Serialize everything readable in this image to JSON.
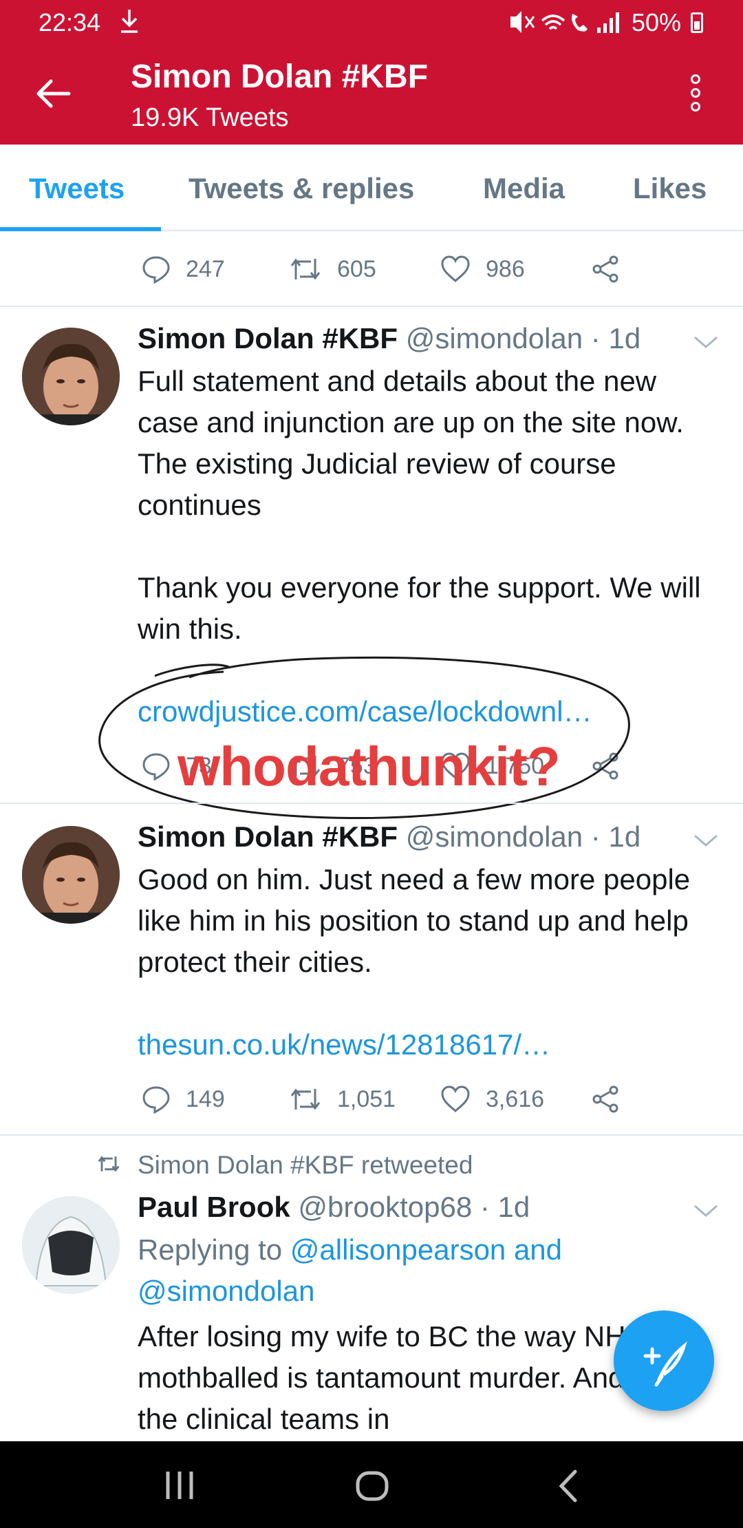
{
  "status_bar": {
    "time": "22:34",
    "download_icon": "download-icon",
    "signal_icons": "mute-icon wifi-icon call-icon signal-icon",
    "battery": "50%"
  },
  "header": {
    "title": "Simon Dolan #KBF",
    "subtitle": "19.9K Tweets"
  },
  "tabs": [
    {
      "label": "Tweets",
      "active": true
    },
    {
      "label": "Tweets & replies",
      "active": false
    },
    {
      "label": "Media",
      "active": false
    },
    {
      "label": "Likes",
      "active": false
    }
  ],
  "tweets": [
    {
      "replies": "247",
      "retweets": "605",
      "likes": "986"
    },
    {
      "name": "Simon Dolan #KBF",
      "meta": "@simondolan · 1d",
      "text": "Full statement and details about the new case and injunction are up on the site now. The existing Judicial review of course continues\n\nThank you everyone for the support. We will win this.",
      "link": "crowdjustice.com/case/lockdownl…",
      "replies": "73",
      "retweets": "753",
      "likes": "1,750"
    },
    {
      "name": "Simon Dolan #KBF",
      "meta": "@simondolan · 1d",
      "text": "Good on him. Just need a few more people like him in his position to stand up and help protect their cities.",
      "link": "thesun.co.uk/news/12818617/…",
      "replies": "149",
      "retweets": "1,051",
      "likes": "3,616"
    },
    {
      "retweeted_by": "Simon Dolan #KBF retweeted",
      "name": "Paul Brook",
      "meta": "@brooktop68 · 1d",
      "replying_prefix": "Replying to ",
      "replying_to": "@allisonpearson and @simondolan",
      "text": "After losing my wife to BC the way NHS was mothballed is tantamount murder. And now the clinical teams in"
    }
  ],
  "annotation": {
    "text": "whodathunkit?",
    "color": "#e53e3e"
  },
  "colors": {
    "brand": "#cc1233",
    "accent": "#1da1f2",
    "link": "#1b95e0",
    "muted": "#657786"
  }
}
